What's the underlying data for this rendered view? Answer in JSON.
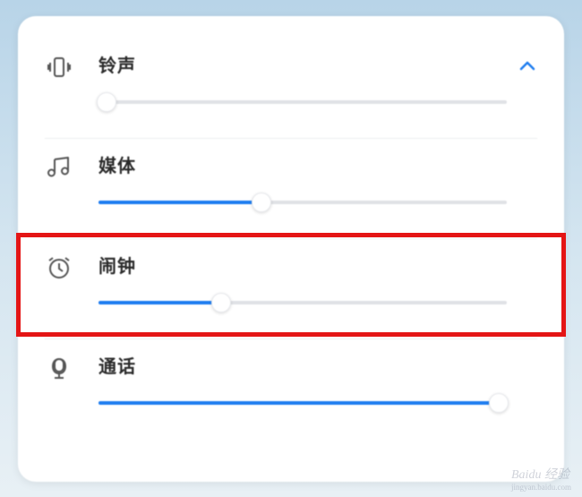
{
  "volumes": {
    "ringtone": {
      "label": "铃声",
      "percent": 2
    },
    "media": {
      "label": "媒体",
      "percent": 40
    },
    "alarm": {
      "label": "闹钟",
      "percent": 30
    },
    "call": {
      "label": "通话",
      "percent": 98
    }
  },
  "expanded": true,
  "highlighted_row": "alarm",
  "watermark": {
    "brand": "Baidu 经验",
    "sub": "jingyan.baidu.com"
  }
}
